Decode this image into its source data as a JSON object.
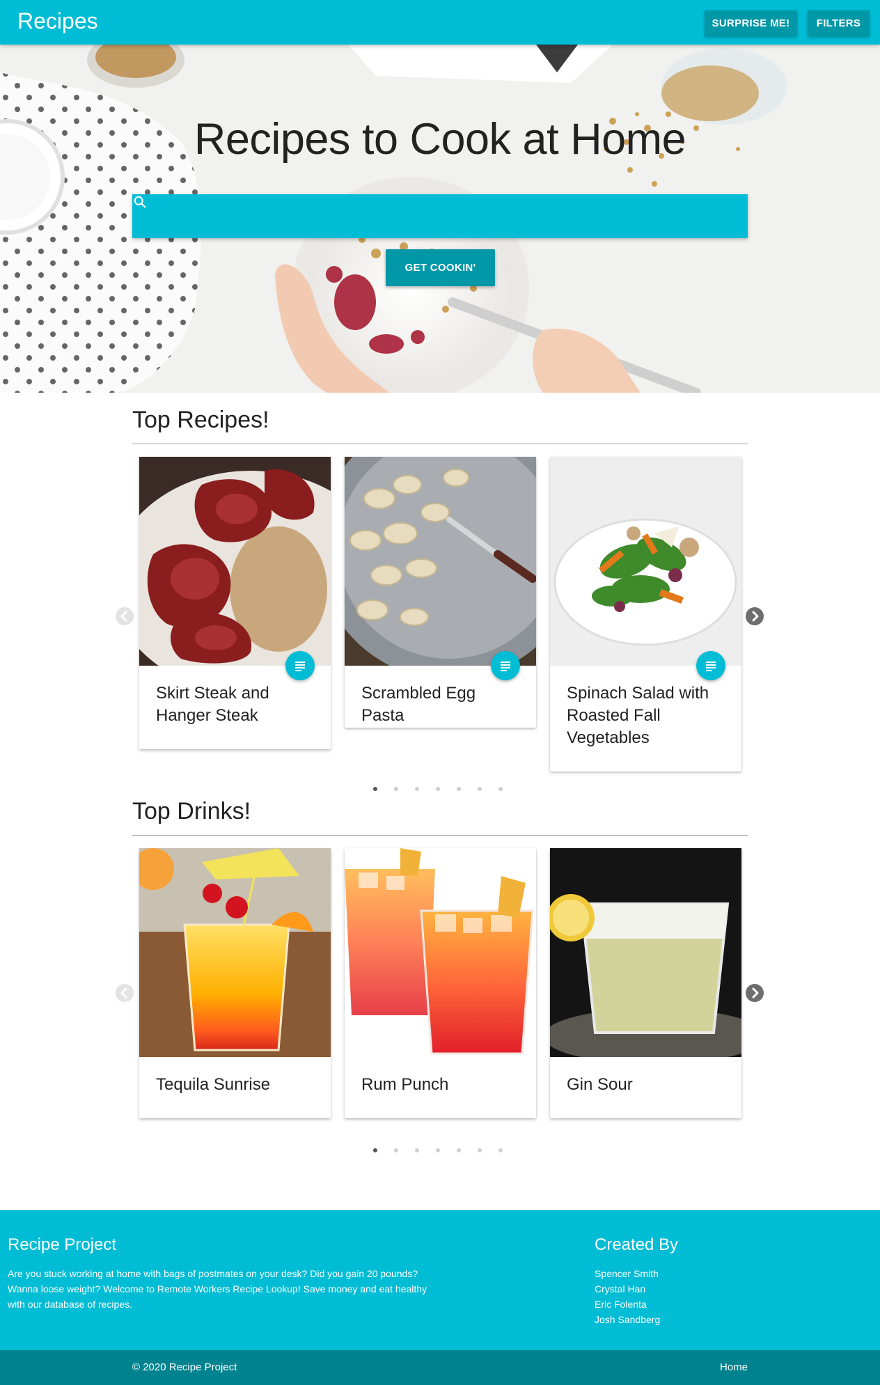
{
  "navbar": {
    "brand": "Recipes",
    "surprise_label": "SURPRISE ME!",
    "filters_label": "FILTERS",
    "color": "#00bcd4",
    "button_color": "#0097a7"
  },
  "hero": {
    "title": "Recipes to Cook at Home",
    "search_placeholder": "",
    "search_value": "",
    "search_icon": "search-icon",
    "button_label": "GET COOKIN'"
  },
  "top_recipes": {
    "heading": "Top Recipes!",
    "cards": [
      {
        "title": "Skirt Steak and Hanger Steak",
        "icon": "notes-icon"
      },
      {
        "title": "Scrambled Egg Pasta",
        "icon": "notes-icon"
      },
      {
        "title": "Spinach Salad with Roasted Fall Vegetables",
        "icon": "notes-icon"
      }
    ],
    "pagination": {
      "total": 7,
      "active": 1
    },
    "prev_icon": "chevron-left-icon",
    "next_icon": "chevron-right-icon"
  },
  "top_drinks": {
    "heading": "Top Drinks!",
    "cards": [
      {
        "title": "Tequila Sunrise"
      },
      {
        "title": "Rum Punch"
      },
      {
        "title": "Gin Sour"
      }
    ],
    "pagination": {
      "total": 7,
      "active": 1
    },
    "prev_icon": "chevron-left-icon",
    "next_icon": "chevron-right-icon"
  },
  "footer": {
    "project_title": "Recipe Project",
    "project_text": "Are you stuck working at home with bags of postmates on your desk? Did you gain 20 pounds? Wanna loose weight? Welcome to Remote Workers Recipe Lookup! Save money and eat healthy with our database of recipes.",
    "created_by_title": "Created By",
    "creators": [
      "Spencer Smith",
      "Crystal Han",
      "Eric Folenta",
      "Josh Sandberg"
    ],
    "copyright": "© 2020 Recipe Project",
    "home_link": "Home",
    "color": "#00bcd4",
    "bottom_color": "#00838f"
  }
}
